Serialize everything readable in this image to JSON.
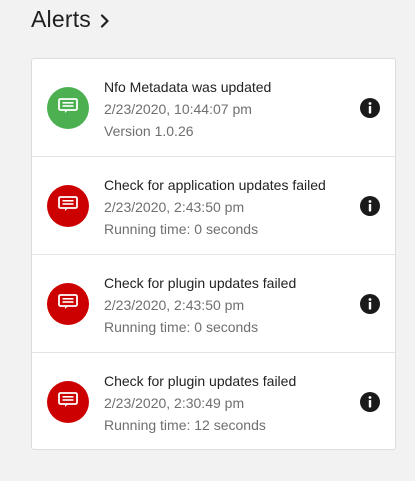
{
  "header": {
    "title": "Alerts",
    "chevron_icon": "chevron-right-icon"
  },
  "colors": {
    "success": "#4caf50",
    "error": "#cc0000"
  },
  "alerts": [
    {
      "title": "Nfo Metadata was updated",
      "date": "2/23/2020, 10:44:07 pm",
      "detail": "Version 1.0.26",
      "status": "success",
      "icon": "message-icon",
      "info_icon": "info-icon"
    },
    {
      "title": "Check for application updates failed",
      "date": "2/23/2020, 2:43:50 pm",
      "detail": "Running time: 0 seconds",
      "status": "error",
      "icon": "message-icon",
      "info_icon": "info-icon"
    },
    {
      "title": "Check for plugin updates failed",
      "date": "2/23/2020, 2:43:50 pm",
      "detail": "Running time: 0 seconds",
      "status": "error",
      "icon": "message-icon",
      "info_icon": "info-icon"
    },
    {
      "title": "Check for plugin updates failed",
      "date": "2/23/2020, 2:30:49 pm",
      "detail": "Running time: 12 seconds",
      "status": "error",
      "icon": "message-icon",
      "info_icon": "info-icon"
    }
  ]
}
